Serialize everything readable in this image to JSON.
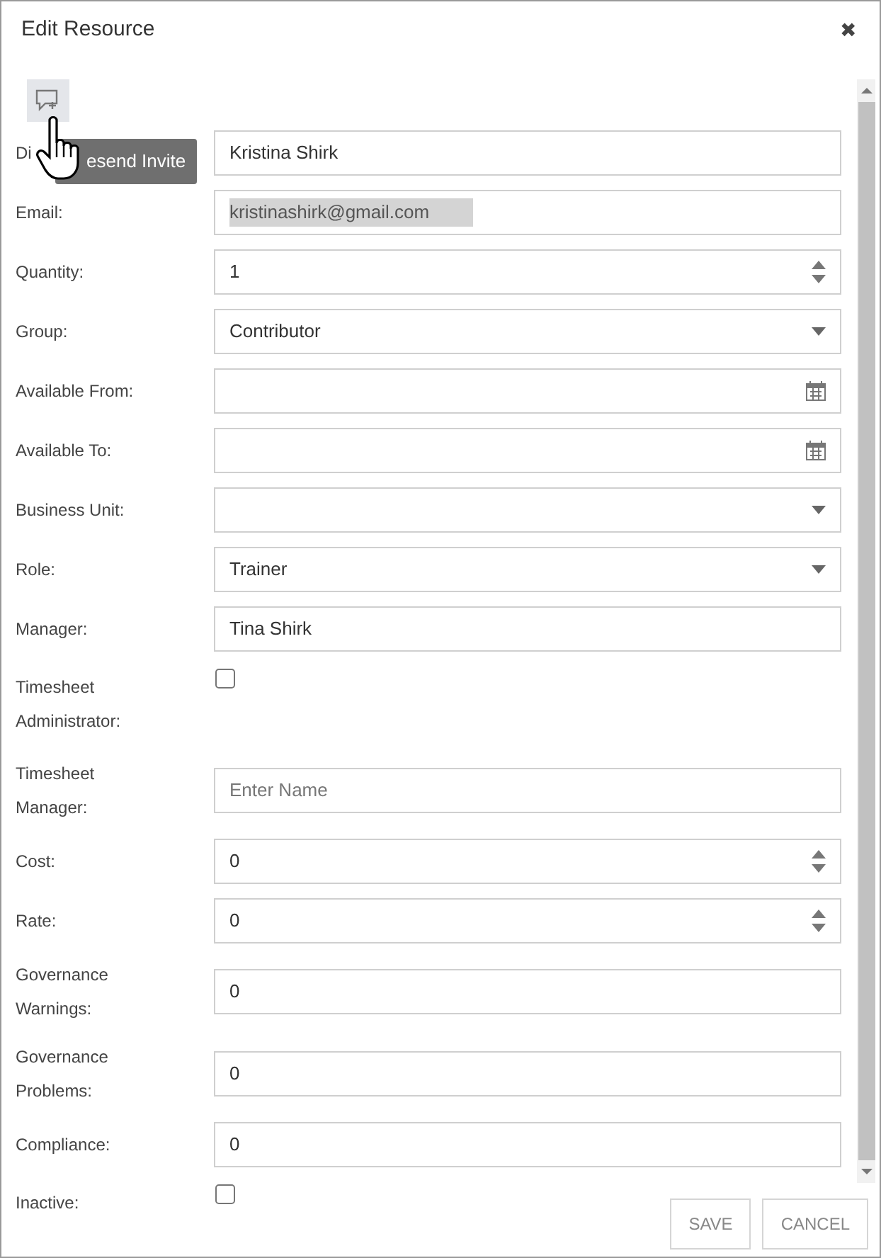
{
  "dialog": {
    "title": "Edit Resource",
    "close": "✖"
  },
  "tooltip": "esend Invite",
  "fields": [
    {
      "label": "Di",
      "kind": "text",
      "value": "Kristina Shirk"
    },
    {
      "label": "Email:",
      "kind": "blurred",
      "value": "kristinashirk@gmail.com"
    },
    {
      "label": "Quantity:",
      "kind": "spinner",
      "value": "1"
    },
    {
      "label": "Group:",
      "kind": "select",
      "value": "Contributor"
    },
    {
      "label": "Available From:",
      "kind": "date"
    },
    {
      "label": "Available To:",
      "kind": "date"
    },
    {
      "label": "Business Unit:",
      "kind": "select"
    },
    {
      "label": "Role:",
      "kind": "select",
      "value": "Trainer"
    },
    {
      "label": "Manager:",
      "kind": "text",
      "value": "Tina Shirk"
    },
    {
      "label": "Timesheet Administrator:",
      "kind": "checkbox",
      "checked": false
    },
    {
      "label": "Timesheet Manager:",
      "kind": "text",
      "placeholder": "Enter Name"
    },
    {
      "label": "Cost:",
      "kind": "spinner",
      "value": "0"
    },
    {
      "label": "Rate:",
      "kind": "spinner",
      "value": "0"
    },
    {
      "label": "Governance Warnings:",
      "kind": "text",
      "value": "0"
    },
    {
      "label": "Governance Problems:",
      "kind": "text",
      "value": "0"
    },
    {
      "label": "Compliance:",
      "kind": "text",
      "value": "0"
    },
    {
      "label": "Inactive:",
      "kind": "checkbox",
      "checked": false
    }
  ],
  "buttons": [
    "SAVE",
    "CANCEL"
  ]
}
